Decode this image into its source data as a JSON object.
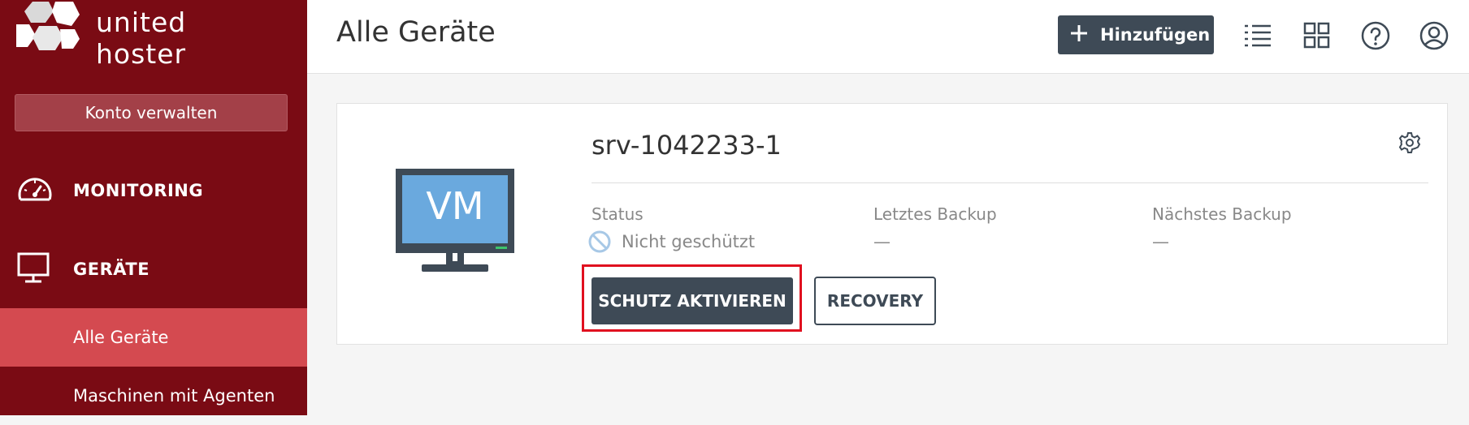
{
  "brand": {
    "name": "united hoster"
  },
  "sidebar": {
    "account_button": "Konto verwalten",
    "sections": [
      {
        "label": "MONITORING",
        "icon": "speedometer-icon"
      },
      {
        "label": "GERÄTE",
        "icon": "monitor-icon"
      }
    ],
    "sub_items": [
      {
        "label": "Alle Geräte",
        "active": true
      },
      {
        "label": "Maschinen mit Agenten",
        "active": false
      }
    ]
  },
  "header": {
    "title": "Alle Geräte",
    "add_button": "Hinzufügen",
    "icons": [
      "list-view-icon",
      "grid-view-icon",
      "help-icon",
      "user-account-icon"
    ]
  },
  "device": {
    "monitor_label": "VM",
    "name": "srv-1042233-1",
    "status_label": "Status",
    "status_value": "Nicht geschützt",
    "last_backup_label": "Letztes Backup",
    "last_backup_value": "—",
    "next_backup_label": "Nächstes Backup",
    "next_backup_value": "—",
    "protect_button": "SCHUTZ AKTIVIEREN",
    "recovery_button": "RECOVERY"
  },
  "colors": {
    "sidebar_bg": "#7a0b14",
    "sidebar_active": "#d44a50",
    "primary_button": "#3e4a56",
    "highlight": "#e0101f"
  }
}
